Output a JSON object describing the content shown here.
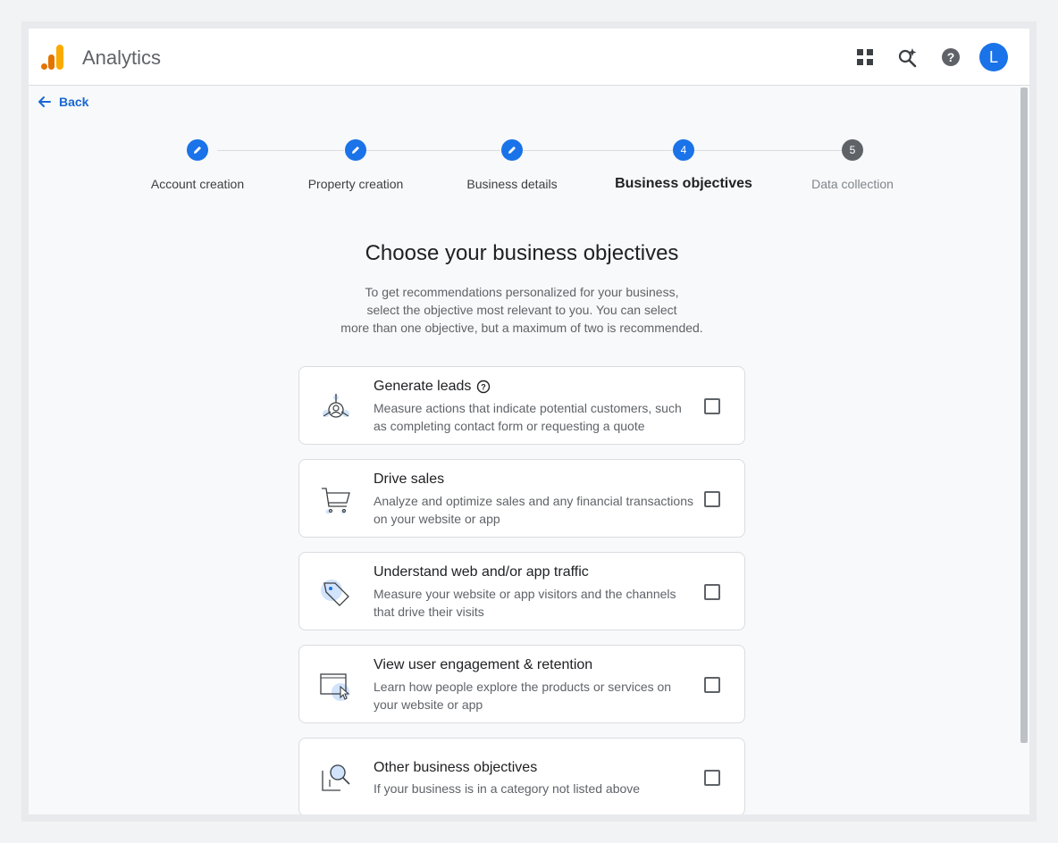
{
  "app": {
    "title": "Analytics",
    "avatar_letter": "L"
  },
  "icons": {
    "apps": "apps-grid-icon",
    "search": "search-spark-icon",
    "help": "help-icon"
  },
  "nav": {
    "back_label": "Back"
  },
  "stepper": {
    "steps": [
      {
        "number": "",
        "label": "Account creation",
        "state": "done"
      },
      {
        "number": "",
        "label": "Property creation",
        "state": "done"
      },
      {
        "number": "",
        "label": "Business details",
        "state": "done"
      },
      {
        "number": "4",
        "label": "Business objectives",
        "state": "active"
      },
      {
        "number": "5",
        "label": "Data collection",
        "state": "pending"
      }
    ]
  },
  "main": {
    "heading": "Choose your business objectives",
    "subtext_lines": [
      "To get recommendations personalized for your business,",
      "select the objective most relevant to you. You can select",
      "more than one objective, but a maximum of two is recommended."
    ],
    "objectives": [
      {
        "title": "Generate leads",
        "desc": "Measure actions that indicate potential customers, such as completing contact form or requesting a quote",
        "checked": false,
        "has_help": true
      },
      {
        "title": "Drive sales",
        "desc": "Analyze and optimize sales and any financial transactions on your website or app",
        "checked": false
      },
      {
        "title": "Understand web and/or app traffic",
        "desc": "Measure your website or app visitors and the channels that drive their visits",
        "checked": false
      },
      {
        "title": "View user engagement & retention",
        "desc": "Learn how people explore the products or services on your website or app",
        "checked": false
      },
      {
        "title": "Other business objectives",
        "desc": "If your business is in a category not listed above",
        "checked": false
      }
    ]
  },
  "colors": {
    "accent": "#1a73e8",
    "pending": "#5f6368",
    "logo_orange": "#e37400",
    "logo_yellow": "#f9ab00"
  }
}
